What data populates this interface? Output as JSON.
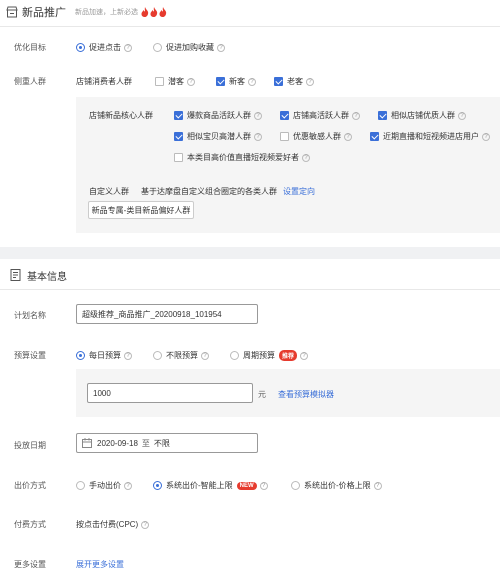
{
  "section1": {
    "title": "新品推广",
    "subtitle": "新品加速，上新必选"
  },
  "optimize": {
    "label": "优化目标",
    "options": [
      "促进点击",
      "促进加购收藏"
    ],
    "selected": 0
  },
  "crowd": {
    "label": "侧重人群",
    "shop_label": "店铺消费者人群",
    "shop_options": [
      {
        "label": "潜客",
        "checked": false
      },
      {
        "label": "新客",
        "checked": true
      },
      {
        "label": "老客",
        "checked": true
      }
    ],
    "core_label": "店铺新品核心人群",
    "core_options": [
      {
        "label": "爆款商品活跃人群",
        "checked": true
      },
      {
        "label": "店铺高活跃人群",
        "checked": true
      },
      {
        "label": "相似店铺优质人群",
        "checked": true
      },
      {
        "label": "相似宝贝高潜人群",
        "checked": true
      },
      {
        "label": "优惠敏感人群",
        "checked": false
      },
      {
        "label": "近期直播和短视频进店用户",
        "checked": true
      },
      {
        "label": "本类目高价值直播短视频爱好者",
        "checked": false
      }
    ],
    "custom_label": "自定义人群",
    "custom_desc": "基于达摩盘自定义组合圈定的各类人群",
    "custom_link": "设置定向",
    "custom_button": "新品专属-类目新品偏好人群"
  },
  "section2": {
    "title": "基本信息"
  },
  "plan": {
    "label": "计划名称",
    "value": "超级推荐_商品推广_20200918_101954"
  },
  "budget": {
    "label": "预算设置",
    "options": [
      "每日预算",
      "不限预算",
      "周期预算"
    ],
    "selected": 0,
    "badge": "推荐",
    "amount": "1000",
    "unit": "元",
    "link": "查看预算模拟器"
  },
  "dates": {
    "label": "投放日期",
    "start": "2020-09-18",
    "sep": "至",
    "end": "不限"
  },
  "bid": {
    "label": "出价方式",
    "options": [
      "手动出价",
      "系统出价-智能上限",
      "系统出价-价格上限"
    ],
    "selected": 1,
    "badge": "NEW"
  },
  "pay": {
    "label": "付费方式",
    "value": "按点击付费(CPC)"
  },
  "more": {
    "label": "更多设置",
    "link": "展开更多设置"
  },
  "colors": {
    "accent": "#3a6fd8",
    "badge_red": "#e63b2e",
    "panel_bg": "#f5f5f5",
    "divider_bg": "#f0f1f3"
  }
}
